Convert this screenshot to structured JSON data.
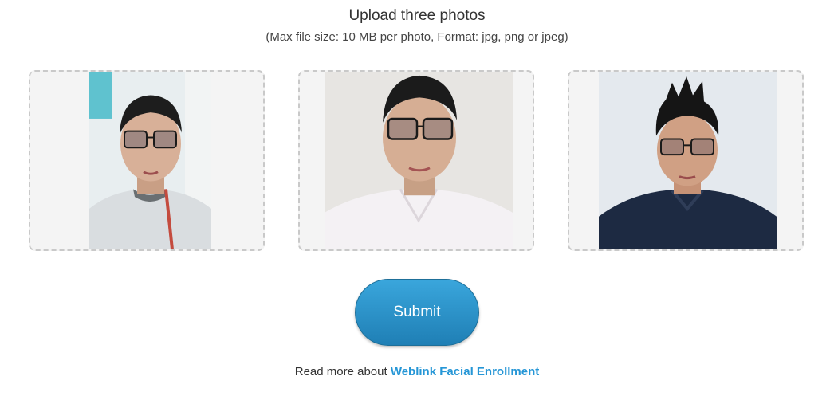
{
  "header": {
    "title": "Upload three photos",
    "subtitle": "(Max file size: 10 MB per photo, Format: jpg, png or jpeg)"
  },
  "photos": [
    {
      "name": "photo-slot-1",
      "icon": "portrait-photo"
    },
    {
      "name": "photo-slot-2",
      "icon": "portrait-photo"
    },
    {
      "name": "photo-slot-3",
      "icon": "portrait-photo"
    }
  ],
  "submit": {
    "label": "Submit"
  },
  "footer": {
    "prefix": "Read more about ",
    "link": "Weblink Facial Enrollment"
  },
  "colors": {
    "button": "#2a8fc8",
    "link": "#2596d6",
    "slot_border": "#c9c9c9"
  }
}
